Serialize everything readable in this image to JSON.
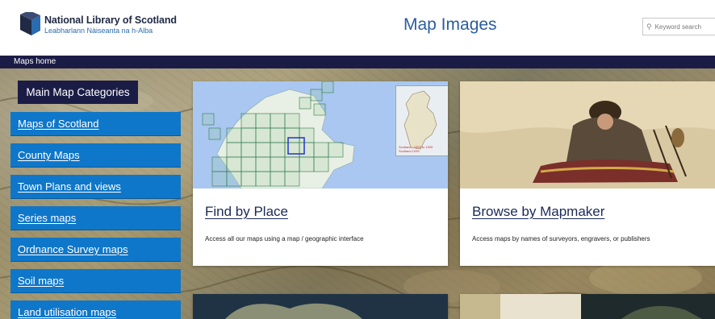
{
  "header": {
    "logo_title": "National Library of Scotland",
    "logo_subtitle": "Leabharlann Nàiseanta na h-Alba",
    "site_title": "Map Images",
    "search_placeholder": "Keyword search"
  },
  "breadcrumb": {
    "label": "Maps home"
  },
  "sidebar": {
    "heading": "Main Map Categories",
    "items": [
      {
        "label": "Maps of Scotland"
      },
      {
        "label": "County Maps"
      },
      {
        "label": "Town Plans and views"
      },
      {
        "label": "Series maps"
      },
      {
        "label": "Ordnance Survey maps"
      },
      {
        "label": "Soil maps"
      },
      {
        "label": "Land utilisation maps"
      }
    ]
  },
  "cards": [
    {
      "title": "Find by Place",
      "description": "Access all our maps using a map / geographic interface"
    },
    {
      "title": "Browse by Mapmaker",
      "description": "Access maps by names of surveyors, engravers, or publishers"
    }
  ],
  "inset_legend": [
    "Scotland : 1853 to 1939",
    "Scotland 1939"
  ],
  "colors": {
    "brand_navy": "#1b1c46",
    "nav_blue": "#0f77c9",
    "title_blue": "#2a5d9f"
  }
}
